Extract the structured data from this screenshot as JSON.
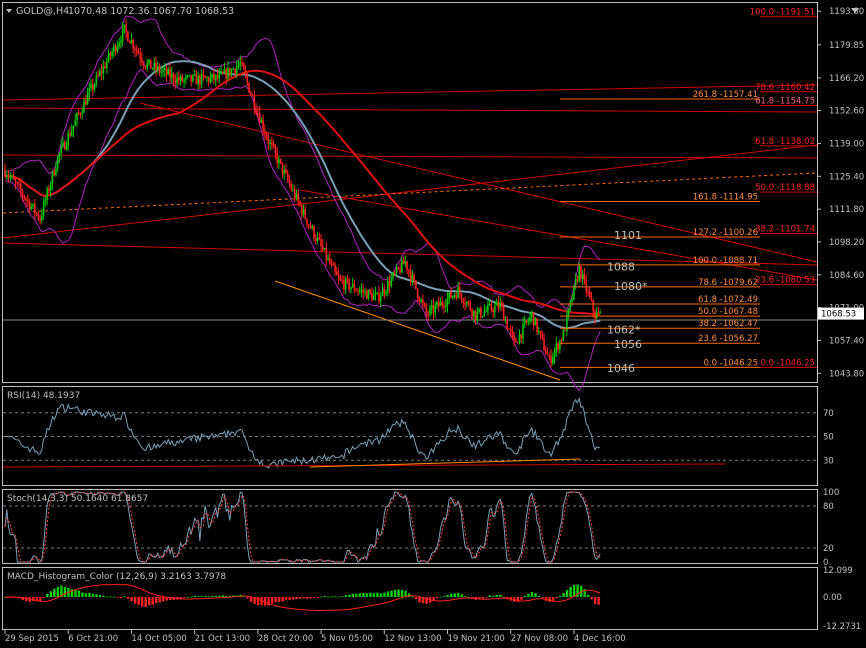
{
  "header": {
    "symbol": "GOLD@,H4",
    "ohlc": "1070.48 1072.36 1067.70 1068.53"
  },
  "colors": {
    "background": "#000000",
    "frame": "#c0c0c0",
    "text": "#c0c0c0",
    "bull": "#00c800",
    "bear": "#ff2020",
    "trend": "#d00000",
    "fib": "#ff6a00",
    "fib_label": "#ff8c40",
    "fib_label_pink": "#ff5a8a",
    "bollinger": "#b020c0",
    "ma_fast": "#7aa0b8",
    "ma_slow": "#e01010",
    "channel_lower": "#ff8c00",
    "rsi": "#7aa0b8",
    "stoch_main": "#7aa0b8",
    "stoch_signal": "#ff4040",
    "macd_pos": "#00d000",
    "macd_neg": "#ff2020",
    "signal_line": "#ff2020",
    "level_box": "#c0c0c0"
  },
  "main_axis": {
    "ticks": [
      "1193.80",
      "1179.85",
      "1166.20",
      "1152.60",
      "1139.00",
      "1125.40",
      "1111.80",
      "1098.20",
      "1084.60",
      "1071.00",
      "1057.40",
      "1043.80"
    ],
    "tick_values": [
      1193.8,
      1179.85,
      1166.2,
      1152.6,
      1139.0,
      1125.4,
      1111.8,
      1098.2,
      1084.6,
      1071.0,
      1057.4,
      1043.8
    ],
    "current_price": "1068.53"
  },
  "fib_left": [
    {
      "label": "261.8 -1157.41",
      "value": 1157.41
    },
    {
      "label": "161.8 -1114.95",
      "value": 1114.95
    },
    {
      "label": "127.2 -1100.26",
      "value": 1100.26
    },
    {
      "label": "100.0 -1088.71",
      "value": 1088.71
    },
    {
      "label": "78.6 -1079.62",
      "value": 1079.62
    },
    {
      "label": "61.8 -1072.49",
      "value": 1072.49
    },
    {
      "label": "50.0 -1067.48",
      "value": 1067.48
    },
    {
      "label": "38.2 -1062.47",
      "value": 1062.47
    },
    {
      "label": "23.6 -1056.27",
      "value": 1056.27
    },
    {
      "label": "0.0 -1046.25",
      "value": 1046.25
    }
  ],
  "fib_right": [
    {
      "label": "100.0 -1191.51",
      "value": 1191.51
    },
    {
      "label": "78.6 -1160.42",
      "value": 1160.42
    },
    {
      "label": "61.8 -1154.75",
      "value": 1154.75
    },
    {
      "label": "61.8 -1138.02",
      "value": 1138.02
    },
    {
      "label": "50.0 -1118.88",
      "value": 1118.88
    },
    {
      "label": "38.2 -1101.74",
      "value": 1101.74
    },
    {
      "label": "23.6 -1080.53",
      "value": 1080.53
    },
    {
      "label": "0.0 -1046.25",
      "value": 1046.25
    }
  ],
  "price_levels": [
    {
      "label": "1101",
      "value": 1101
    },
    {
      "label": "1088",
      "value": 1088
    },
    {
      "label": "1080*",
      "value": 1080
    },
    {
      "label": "1062*",
      "value": 1062
    },
    {
      "label": "1056",
      "value": 1056
    },
    {
      "label": "1046",
      "value": 1046
    }
  ],
  "rsi": {
    "title": "RSI(14) 48.1937",
    "ticks": [
      "70",
      "50",
      "30"
    ],
    "tick_values": [
      70,
      50,
      30
    ],
    "ylim": [
      10,
      90
    ]
  },
  "stoch": {
    "title": "Stoch(14,3,3) 50.1640 61.8657",
    "ticks": [
      "100",
      "80",
      "20",
      "0"
    ],
    "tick_values": [
      100,
      80,
      20,
      0
    ]
  },
  "macd": {
    "title": "MACD_Histogram_Color (12,26,9) 3.2163 3.7978",
    "ticks": [
      "12.099",
      "0.00",
      "-12.2731"
    ],
    "tick_values": [
      12.099,
      0.0,
      -12.2731
    ]
  },
  "x_axis": {
    "labels": [
      "29 Sep 2015",
      "6 Oct 21:00",
      "14 Oct 05:00",
      "21 Oct 13:00",
      "28 Oct 20:00",
      "5 Nov 05:00",
      "12 Nov 13:00",
      "19 Nov 21:00",
      "27 Nov 08:00",
      "4 Dec 16:00"
    ],
    "positions": [
      0,
      36,
      72,
      108,
      144,
      180,
      216,
      252,
      288,
      324
    ]
  },
  "chart_data": {
    "type": "candlestick",
    "symbol": "GOLD@",
    "timeframe": "H4",
    "bar_count": 340,
    "ylim": [
      1040.2,
      1197.2
    ],
    "price_path": [
      {
        "bar": 0,
        "price": 1128
      },
      {
        "bar": 20,
        "price": 1108
      },
      {
        "bar": 30,
        "price": 1133
      },
      {
        "bar": 48,
        "price": 1160
      },
      {
        "bar": 68,
        "price": 1186
      },
      {
        "bar": 80,
        "price": 1172
      },
      {
        "bar": 100,
        "price": 1165
      },
      {
        "bar": 122,
        "price": 1166
      },
      {
        "bar": 134,
        "price": 1172
      },
      {
        "bar": 150,
        "price": 1140
      },
      {
        "bar": 170,
        "price": 1110
      },
      {
        "bar": 190,
        "price": 1082
      },
      {
        "bar": 212,
        "price": 1075
      },
      {
        "bar": 228,
        "price": 1090
      },
      {
        "bar": 240,
        "price": 1068
      },
      {
        "bar": 258,
        "price": 1078
      },
      {
        "bar": 268,
        "price": 1068
      },
      {
        "bar": 282,
        "price": 1072
      },
      {
        "bar": 290,
        "price": 1056
      },
      {
        "bar": 300,
        "price": 1068
      },
      {
        "bar": 310,
        "price": 1049
      },
      {
        "bar": 318,
        "price": 1060
      },
      {
        "bar": 327,
        "price": 1087
      },
      {
        "bar": 336,
        "price": 1068
      }
    ]
  }
}
